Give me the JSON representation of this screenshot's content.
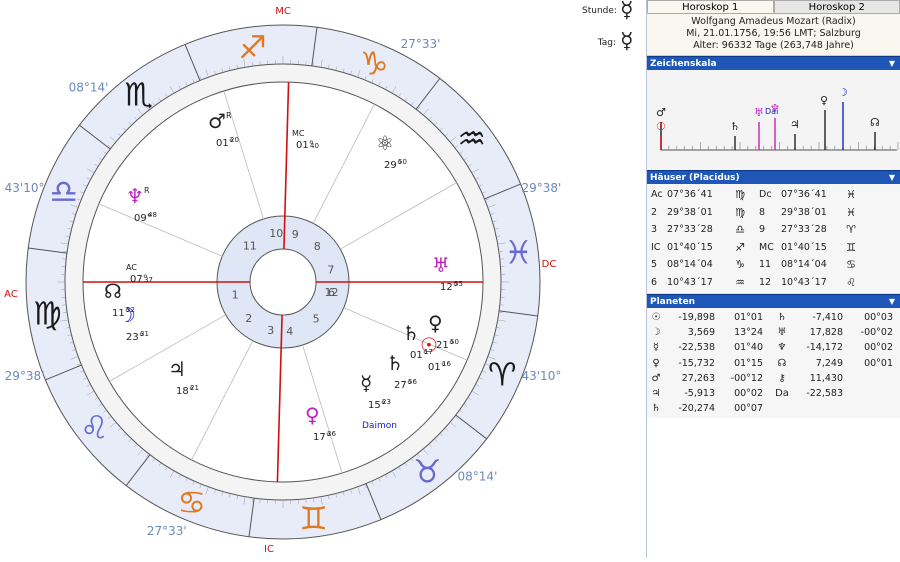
{
  "chart": {
    "axis_labels": {
      "mc": "MC",
      "ic": "IC",
      "ac": "AC",
      "dc": "DC"
    },
    "outer_degrees": [
      "08°14'",
      "27°33'",
      "29°38'",
      "43'10°",
      "08°14'",
      "27°33'",
      "29°38'",
      "43'10°"
    ],
    "house_numbers": [
      "1",
      "2",
      "3",
      "4",
      "5",
      "6",
      "7",
      "8",
      "9",
      "10",
      "11",
      "12"
    ],
    "planet_labels": [
      {
        "glyph": "♂",
        "deg": "01°",
        "min": "20",
        "retro": "R",
        "color": "#222"
      },
      {
        "glyph": "MC",
        "deg": "01°",
        "min": "40",
        "retro": "",
        "color": "#222"
      },
      {
        "glyph": "⚛",
        "deg": "29°",
        "min": "50",
        "retro": "",
        "color": "#222"
      },
      {
        "glyph": "♆",
        "deg": "09°",
        "min": "48",
        "retro": "R",
        "color": "#c020c0"
      },
      {
        "glyph": "AC",
        "deg": "07°",
        "min": "37",
        "retro": "",
        "color": "#222"
      },
      {
        "glyph": "☊",
        "deg": "11°",
        "min": "32",
        "retro": "",
        "color": "#222"
      },
      {
        "glyph": "☽",
        "deg": "23°",
        "min": "31",
        "retro": "",
        "color": "#1a20c8"
      },
      {
        "glyph": "♃",
        "deg": "18°",
        "min": "21",
        "retro": "",
        "color": "#222"
      },
      {
        "glyph": "♀",
        "deg": "17°",
        "min": "36",
        "retro": "",
        "color": "#c020c0"
      },
      {
        "glyph": "☿",
        "deg": "15°",
        "min": "23",
        "retro": "",
        "color": "#222"
      },
      {
        "glyph": "♄",
        "deg": "27°",
        "min": "56",
        "retro": "",
        "color": "#222"
      },
      {
        "glyph": "☉",
        "deg": "01°",
        "min": "16",
        "retro": "",
        "color": "#d01010"
      },
      {
        "glyph": "♀",
        "deg": "21°",
        "min": "50",
        "retro": "",
        "color": "#222"
      },
      {
        "glyph": "♅",
        "deg": "12°",
        "min": "55",
        "retro": "",
        "color": "#c020c0"
      },
      {
        "glyph": "♄",
        "deg": "01°",
        "min": "17",
        "retro": "",
        "color": "#222"
      }
    ],
    "daimon_label": "Daimon"
  },
  "day_ruler": {
    "hour_label": "Stunde:",
    "hour_glyph": "☿",
    "day_label": "Tag:",
    "day_glyph": "☿"
  },
  "tabs": [
    {
      "label": "Horoskop 1"
    },
    {
      "label": "Horoskop 2"
    }
  ],
  "info": {
    "name": "Wolfgang Amadeus Mozart (Radix)",
    "date": "Mi, 21.01.1756, 19:56 LMT; Salzburg",
    "age": "Alter: 96332 Tage (263,748 Jahre)"
  },
  "sections": {
    "zodiac_scale": "Zeichenskala",
    "houses": "Häuser (Placidus)",
    "planets": "Planeten"
  },
  "zodiac_scale_glyphs": {
    "dai": "Dai"
  },
  "houses": [
    {
      "a": "Ac",
      "av": "07°36´41",
      "as": "♍",
      "b": "Dc",
      "bv": "07°36´41",
      "bs": "♓"
    },
    {
      "a": "2",
      "av": "29°38´01",
      "as": "♍",
      "b": "8",
      "bv": "29°38´01",
      "bs": "♓"
    },
    {
      "a": "3",
      "av": "27°33´28",
      "as": "♎",
      "b": "9",
      "bv": "27°33´28",
      "bs": "♈"
    },
    {
      "a": "IC",
      "av": "01°40´15",
      "as": "♐",
      "b": "MC",
      "bv": "01°40´15",
      "bs": "♊"
    },
    {
      "a": "5",
      "av": "08°14´04",
      "as": "♑",
      "b": "11",
      "bv": "08°14´04",
      "bs": "♋"
    },
    {
      "a": "6",
      "av": "10°43´17",
      "as": "♒",
      "b": "12",
      "bv": "10°43´17",
      "bs": "♌"
    }
  ],
  "planets": [
    {
      "g": "☉",
      "v": "-19,898",
      "d": "01°01",
      "g2": "♄",
      "v2": "-7,410",
      "d2": "00°03"
    },
    {
      "g": "☽",
      "v": "3,569",
      "d": "13°24",
      "g2": "♅",
      "v2": "17,828",
      "d2": "-00°02"
    },
    {
      "g": "☿",
      "v": "-22,538",
      "d": "01°40",
      "g2": "♆",
      "v2": "-14,172",
      "d2": "00°02"
    },
    {
      "g": "♀",
      "v": "-15,732",
      "d": "01°15",
      "g2": "☊",
      "v2": "7,249",
      "d2": "00°01"
    },
    {
      "g": "♂",
      "v": "27,263",
      "d": "-00°12",
      "g2": "⚷",
      "v2": "11,430",
      "d2": ""
    },
    {
      "g": "♃",
      "v": "-5,913",
      "d": "00°02",
      "g2": "Da",
      "v2": "-22,583",
      "d2": ""
    },
    {
      "g": "♄",
      "v": "-20,274",
      "d": "00°07",
      "g2": "",
      "v2": "",
      "d2": ""
    }
  ],
  "colors": {
    "accent": "#1f57b8",
    "zodiac_ring": "#e8ecf8",
    "axis": "#d01010",
    "house_ring": "#dfe6f6"
  }
}
